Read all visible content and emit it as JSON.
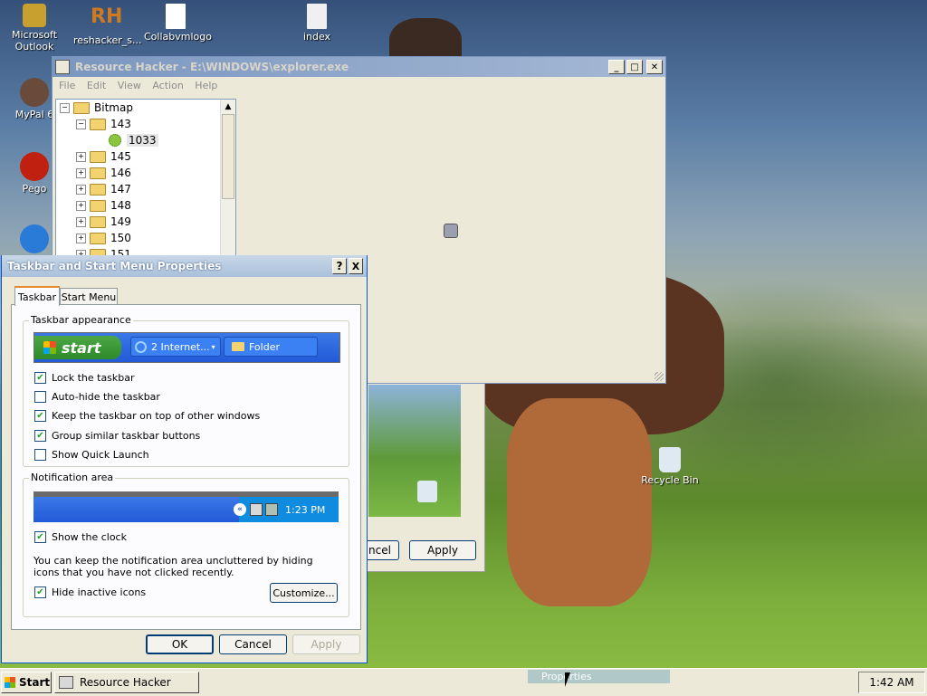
{
  "desktop": {
    "icons": [
      {
        "label": "Microsoft Outlook",
        "icon": "outlook-icon",
        "color": "#c8a030"
      },
      {
        "label": "reshacker_s...",
        "icon": "reshacker-icon",
        "color": "#d07a20"
      },
      {
        "label": "Collabvmlogo",
        "icon": "image-file-icon",
        "color": "#3c78d8"
      },
      {
        "label": "index",
        "icon": "html-file-icon",
        "color": "#d06030"
      },
      {
        "label": "MyPal 6",
        "icon": "mypal-icon",
        "color": "#6a4a3a"
      },
      {
        "label": "Pego",
        "icon": "pego-icon",
        "color": "#c02010"
      },
      {
        "label": "",
        "icon": "update-icon",
        "color": "#2a7ad8"
      },
      {
        "label": "Recycle Bin",
        "icon": "recycle-bin-icon",
        "color": "#4aa84a"
      }
    ]
  },
  "resource_hacker": {
    "title": "Resource Hacker  -  E:\\WINDOWS\\explorer.exe",
    "menu": [
      "File",
      "Edit",
      "View",
      "Action",
      "Help"
    ],
    "tree": {
      "root": "Bitmap",
      "expanded": "143",
      "leaf": "1033",
      "items": [
        "145",
        "146",
        "147",
        "148",
        "149",
        "150",
        "151"
      ]
    }
  },
  "behind_dialog": {
    "cancel_label": "ncel",
    "apply_label": "Apply"
  },
  "taskbar_dialog": {
    "title": "Taskbar and Start Menu Properties",
    "help_button": "?",
    "close_button": "X",
    "tabs": [
      "Taskbar",
      "Start Menu"
    ],
    "appearance_group": "Taskbar appearance",
    "preview": {
      "start_label": "start",
      "task1": "2 Internet...",
      "task2": "Folder"
    },
    "options": [
      {
        "label": "Lock the taskbar",
        "checked": true
      },
      {
        "label": "Auto-hide the taskbar",
        "checked": false
      },
      {
        "label": "Keep the taskbar on top of other windows",
        "checked": true
      },
      {
        "label": "Group similar taskbar buttons",
        "checked": true
      },
      {
        "label": "Show Quick Launch",
        "checked": false
      }
    ],
    "notification_group": "Notification area",
    "tray_time": "1:23 PM",
    "show_clock": {
      "label": "Show the clock",
      "checked": true
    },
    "info_text": "You can keep the notification area uncluttered by hiding icons that you have not clicked recently.",
    "hide_inactive": {
      "label": "Hide inactive icons",
      "checked": true
    },
    "customize_label": "Customize...",
    "ok_label": "OK",
    "cancel_label": "Cancel",
    "apply_label": "Apply"
  },
  "taskbar": {
    "start_label": "Start",
    "task_label": "Resource Hacker",
    "clock": "1:42 AM",
    "context_item": "Properties"
  }
}
